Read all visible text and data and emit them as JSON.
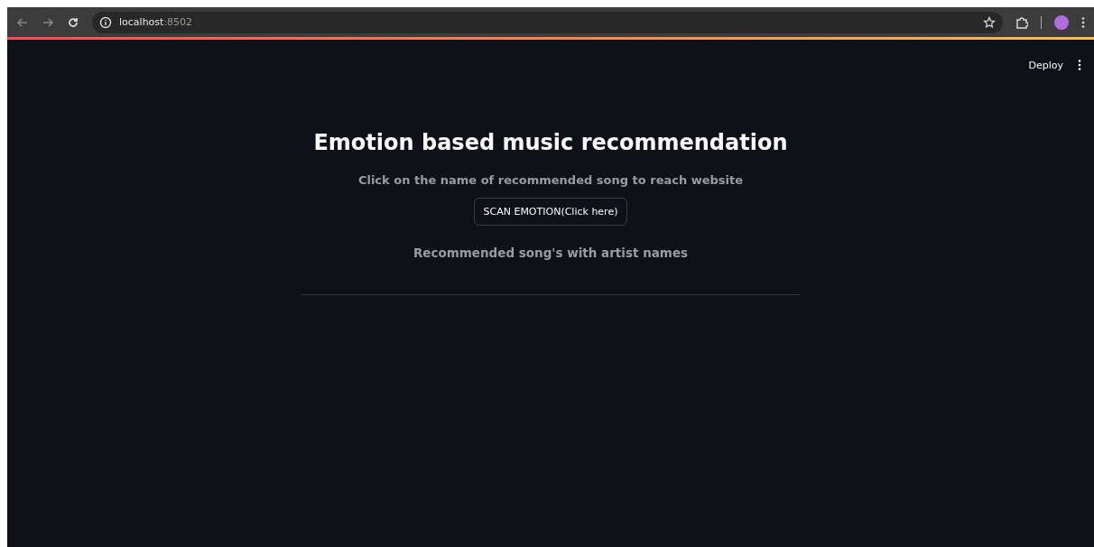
{
  "browser": {
    "url_host": "localhost",
    "url_port": ":8502"
  },
  "app_header": {
    "deploy": "Deploy"
  },
  "main": {
    "title": "Emotion based music recommendation",
    "subtitle": "Click on the name of recommended song to reach website",
    "scan_button": "SCAN EMOTION(Click here)",
    "results_heading": "Recommended song's with artist names"
  }
}
